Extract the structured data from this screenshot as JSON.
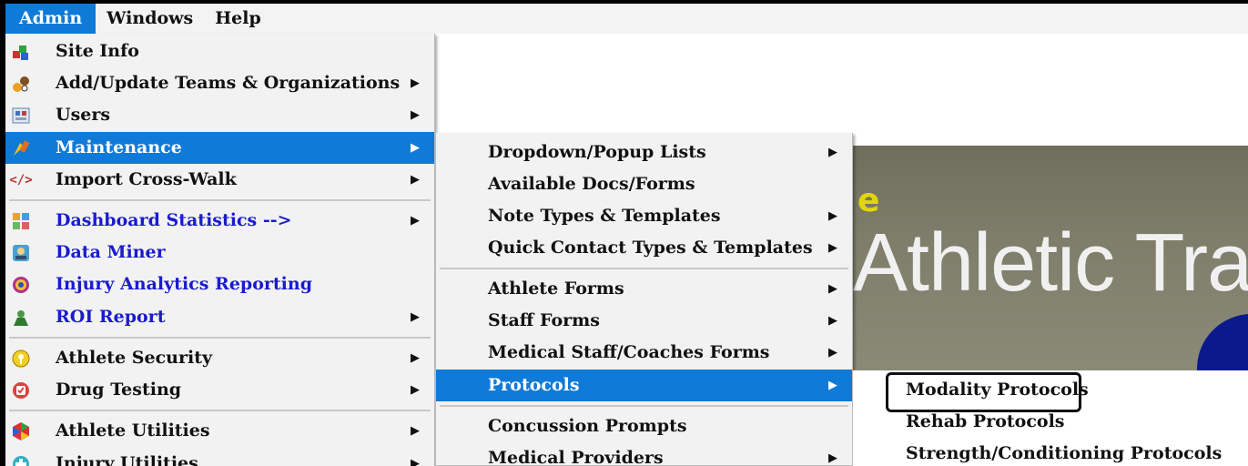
{
  "menubar": {
    "items": [
      {
        "label": "Admin",
        "active": true
      },
      {
        "label": "Windows",
        "active": false
      },
      {
        "label": "Help",
        "active": false
      }
    ]
  },
  "admin_menu": {
    "items": [
      {
        "label": "Site Info",
        "icon": "site-info-icon",
        "submenu": false
      },
      {
        "label": "Add/Update Teams & Organizations",
        "icon": "teams-icon",
        "submenu": true
      },
      {
        "label": "Users",
        "icon": "users-icon",
        "submenu": true
      },
      {
        "label": "Maintenance",
        "icon": "maintenance-icon",
        "submenu": true,
        "selected": true
      },
      {
        "label": "Import Cross-Walk",
        "icon": "code-icon",
        "submenu": true
      },
      {
        "label": "Dashboard Statistics -->",
        "icon": "dashboard-icon",
        "submenu": true,
        "link_style": true
      },
      {
        "label": "Data Miner",
        "icon": "data-miner-icon",
        "submenu": false,
        "link_style": true
      },
      {
        "label": "Injury Analytics Reporting",
        "icon": "analytics-icon",
        "submenu": false,
        "link_style": true
      },
      {
        "label": "ROI Report",
        "icon": "roi-icon",
        "submenu": true,
        "link_style": true
      },
      {
        "label": "Athlete Security",
        "icon": "security-icon",
        "submenu": true
      },
      {
        "label": "Drug Testing",
        "icon": "drug-testing-icon",
        "submenu": true
      },
      {
        "label": "Athlete Utilities",
        "icon": "athlete-utilities-icon",
        "submenu": true
      },
      {
        "label": "Injury Utilities",
        "icon": "injury-utilities-icon",
        "submenu": true
      }
    ]
  },
  "maintenance_menu": {
    "items": [
      {
        "label": "Dropdown/Popup Lists",
        "submenu": true
      },
      {
        "label": "Available Docs/Forms",
        "submenu": false
      },
      {
        "label": "Note Types & Templates",
        "submenu": true
      },
      {
        "label": "Quick Contact Types & Templates",
        "submenu": true
      },
      {
        "label": "Athlete Forms",
        "submenu": true
      },
      {
        "label": "Staff Forms",
        "submenu": true
      },
      {
        "label": "Medical Staff/Coaches Forms",
        "submenu": true
      },
      {
        "label": "Protocols",
        "submenu": true,
        "selected": true
      },
      {
        "label": "Concussion Prompts",
        "submenu": false
      },
      {
        "label": "Medical Providers",
        "submenu": true
      }
    ]
  },
  "protocols_menu": {
    "items": [
      {
        "label": "Modality Protocols",
        "highlighted": true
      },
      {
        "label": "Rehab Protocols"
      },
      {
        "label": "Strength/Conditioning Protocols"
      }
    ]
  },
  "banner": {
    "partial_letter": "e",
    "title": "Athletic Tra"
  },
  "colors": {
    "selection": "#0f7ad8",
    "link_text": "#1a1ad0",
    "menu_bg": "#f2f2f2"
  },
  "arrow_glyph": "▶"
}
